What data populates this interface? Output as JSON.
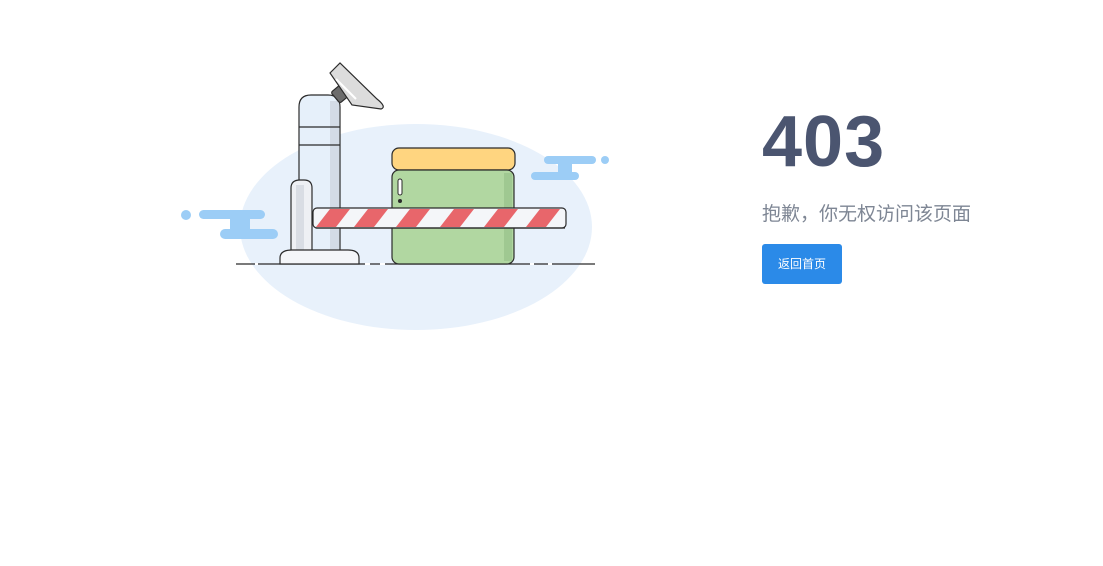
{
  "error": {
    "code": "403",
    "message": "抱歉，你无权访问该页面"
  },
  "actions": {
    "home_button_label": "返回首页"
  },
  "colors": {
    "code_text": "#4b5570",
    "message_text": "#7e8694",
    "button_bg": "#2b8ae8",
    "illustration_bg": "#e8f1fb",
    "cloud": "#9ccdf6",
    "box_top": "#ffd580",
    "box_body": "#b1d7a1",
    "barrier_stripe": "#e8666b"
  },
  "illustration": {
    "icon": "forbidden-barrier-illustration"
  }
}
